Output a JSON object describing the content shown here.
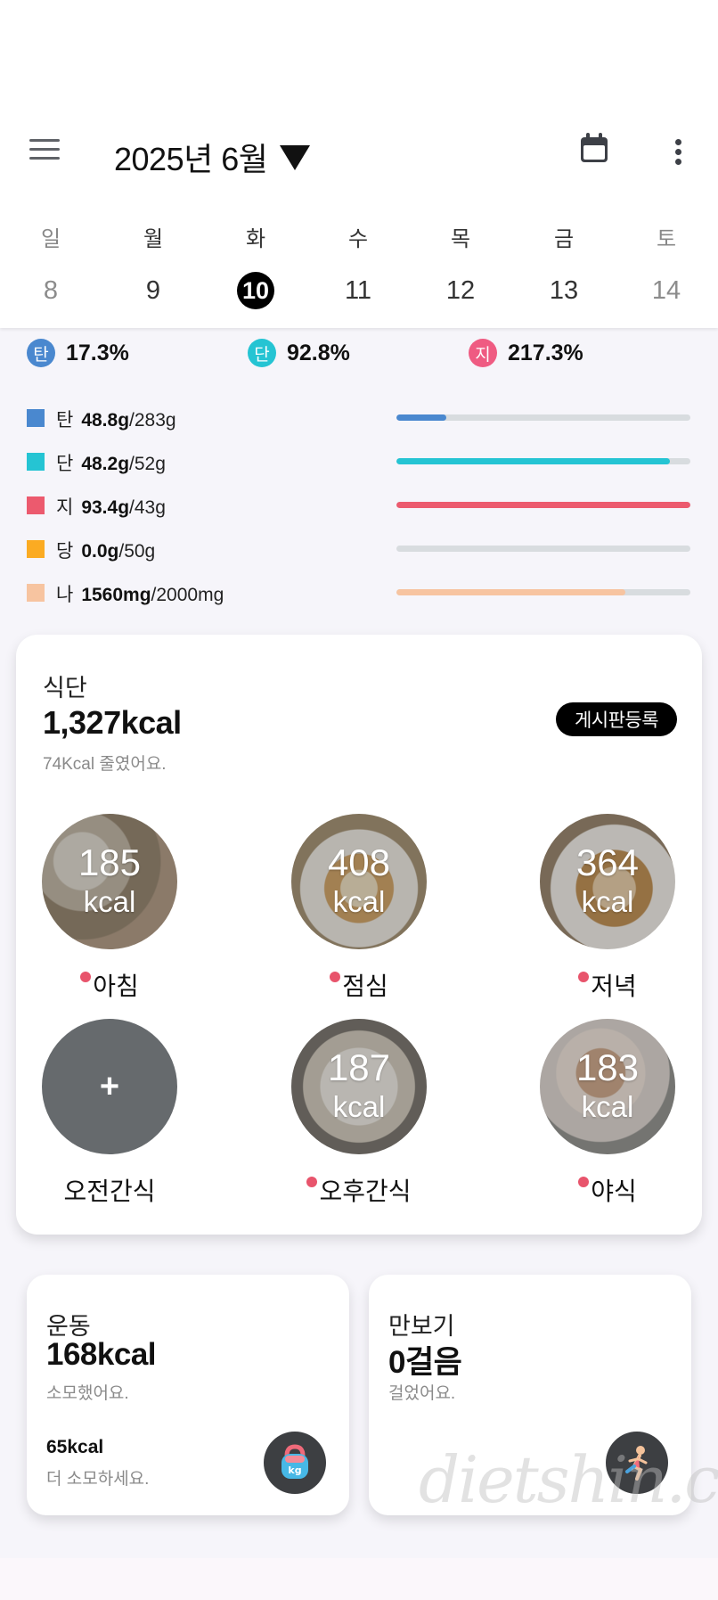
{
  "header": {
    "month_title": "2025년 6월"
  },
  "week": {
    "weekdays": [
      "일",
      "월",
      "화",
      "수",
      "목",
      "금",
      "토"
    ],
    "dates": [
      "8",
      "9",
      "10",
      "11",
      "12",
      "13",
      "14"
    ],
    "selected_index": 2
  },
  "ratios": [
    {
      "badge": "탄",
      "value": "17.3%",
      "color": "#4a88cf"
    },
    {
      "badge": "단",
      "value": "92.8%",
      "color": "#25c4d3"
    },
    {
      "badge": "지",
      "value": "217.3%",
      "color": "#ef5b82"
    }
  ],
  "nutrients": [
    {
      "name": "탄",
      "amount": "48.8g",
      "goal": "/283g",
      "color": "#4a88cf",
      "fraction": 0.17
    },
    {
      "name": "단",
      "amount": "48.2g",
      "goal": "/52g",
      "color": "#25c4d3",
      "fraction": 0.93
    },
    {
      "name": "지",
      "amount": "93.4g",
      "goal": "/43g",
      "color": "#ec5a6e",
      "fraction": 1.0
    },
    {
      "name": "당",
      "amount": "0.0g",
      "goal": "/50g",
      "color": "#fbab22",
      "fraction": 0.0
    },
    {
      "name": "나",
      "amount": "1560mg",
      "goal": "/2000mg",
      "color": "#f7c4a0",
      "fraction": 0.78
    }
  ],
  "diet": {
    "label": "식단",
    "total": "1,327kcal",
    "sub": "74Kcal 줄였어요.",
    "board_button": "게시판등록",
    "meals": [
      {
        "kcal": "185",
        "unit": "kcal",
        "name": "아침",
        "has_dot": true
      },
      {
        "kcal": "408",
        "unit": "kcal",
        "name": "점심",
        "has_dot": true
      },
      {
        "kcal": "364",
        "unit": "kcal",
        "name": "저녁",
        "has_dot": true
      },
      {
        "add": "+",
        "name": "오전간식",
        "has_dot": false
      },
      {
        "kcal": "187",
        "unit": "kcal",
        "name": "오후간식",
        "has_dot": true
      },
      {
        "kcal": "183",
        "unit": "kcal",
        "name": "야식",
        "has_dot": true
      }
    ]
  },
  "exercise": {
    "title": "운동",
    "kcal": "168kcal",
    "sub": "소모했어요.",
    "remain": "65kcal",
    "remain_sub": "더 소모하세요.",
    "icon_text": "kg"
  },
  "pedometer": {
    "title": "만보기",
    "steps": "0걸음",
    "sub": "걸었어요."
  },
  "watermark": "dietshin.com"
}
